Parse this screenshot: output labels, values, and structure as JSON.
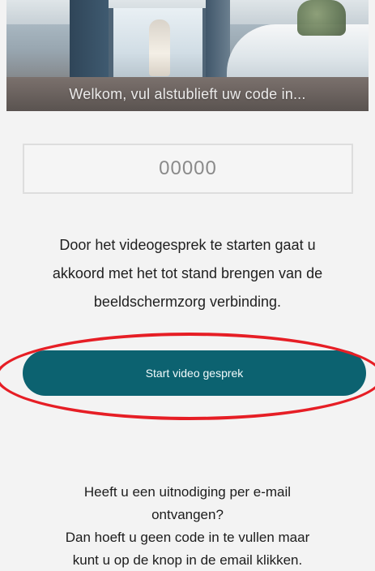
{
  "header": {
    "welcome_text": "Welkom, vul alstublieft uw code in..."
  },
  "code_input": {
    "placeholder": "00000",
    "value": ""
  },
  "consent": {
    "lines": [
      "Door het videogesprek te starten gaat u",
      "akkoord met het tot stand brengen van de",
      "beeldschermzorg verbinding."
    ]
  },
  "start_button": {
    "label": "Start video gesprek",
    "color": "#0c6270"
  },
  "annotation": {
    "color": "#e61e25"
  },
  "invite": {
    "lines": [
      "Heeft u een uitnodiging per e-mail",
      "ontvangen?",
      "Dan hoeft u geen code in te vullen maar",
      "kunt u op de knop in de email klikken."
    ]
  }
}
